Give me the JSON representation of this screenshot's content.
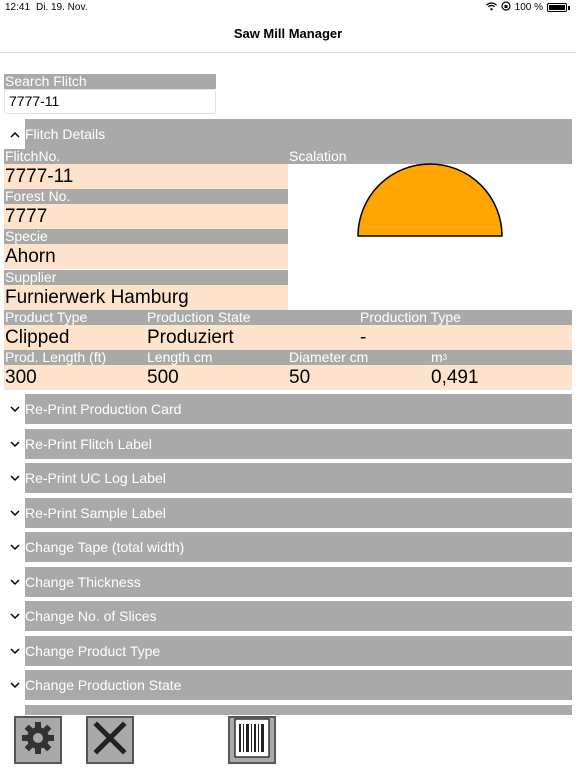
{
  "status_bar": {
    "time": "12:41",
    "date": "Di. 19. Nov.",
    "battery": "100 %"
  },
  "nav": {
    "title": "Saw Mill Manager"
  },
  "search": {
    "label": "Search Flitch",
    "value": "7777-11"
  },
  "details": {
    "header": "Flitch Details",
    "flitch_no_label": "FlitchNo.",
    "flitch_no": "7777-11",
    "scalation_label": "Scalation",
    "forest_no_label": "Forest No.",
    "forest_no": "7777",
    "specie_label": "Specie",
    "specie": "Ahorn",
    "supplier_label": "Supplier",
    "supplier": "Furnierwerk Hamburg",
    "product_type_label": "Product Type",
    "product_type": "Clipped",
    "production_state_label": "Production State",
    "production_state": "Produziert",
    "production_type_label": "Production Type",
    "production_type": "-",
    "prod_length_label": "Prod. Length (ft)",
    "prod_length": "300",
    "length_cm_label": "Length cm",
    "length_cm": "500",
    "diameter_label": "Diameter cm",
    "diameter": "50",
    "volume_label": "m",
    "volume_label_sup": "3",
    "volume": "0,491"
  },
  "scalation_colors": {
    "fill": "#ffa500",
    "stroke": "#000000"
  },
  "actions": [
    {
      "label": "Re-Print Production Card"
    },
    {
      "label": "Re-Print Flitch Label"
    },
    {
      "label": "Re-Print UC Log Label"
    },
    {
      "label": "Re-Print Sample Label"
    },
    {
      "label": "Change Tape (total width)"
    },
    {
      "label": "Change Thickness"
    },
    {
      "label": "Change No. of Slices"
    },
    {
      "label": "Change Product Type"
    },
    {
      "label": "Change Production State"
    }
  ],
  "toolbar": {
    "icons": [
      "gear-icon",
      "close-icon",
      "barcode-icon"
    ]
  }
}
